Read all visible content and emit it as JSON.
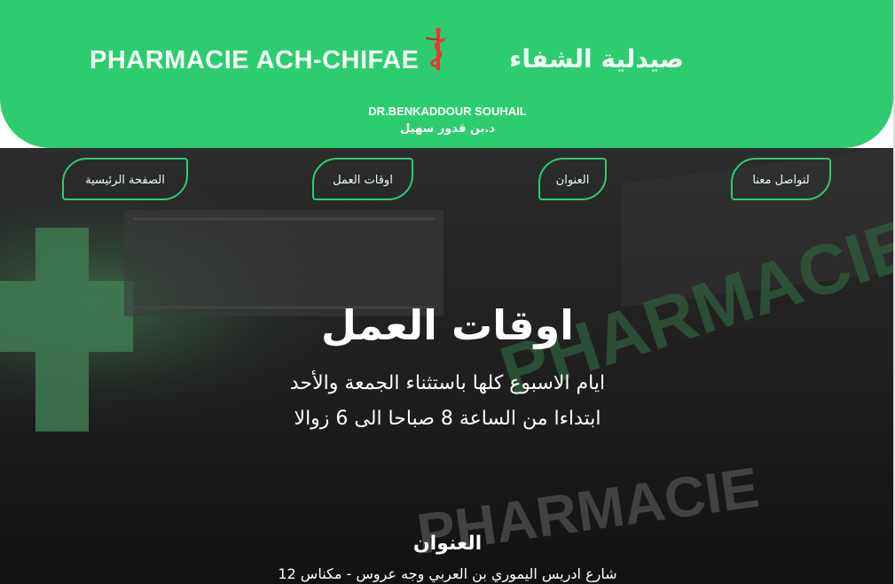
{
  "header": {
    "brand_latin": "PHARMACIE ACH-CHIFAE",
    "brand_arabic": "صيدلية الشفاء",
    "doctor_latin": "DR.BENKADDOUR SOUHAIL",
    "doctor_arabic": "د.بن قدور سهيل",
    "logo_icon": "caduceus-icon",
    "accent_color": "#2ecc71"
  },
  "nav": {
    "home": "الصفحة الرئيسية",
    "hours": "اوقات العمل",
    "address": "العنوان",
    "contact": "لتواصل معنا"
  },
  "hours_section": {
    "title": "اوقات العمل",
    "line1": "ايام الاسبوع كلها باستثناء الجمعة والأحد",
    "line2": "ابتداءا من الساعة 8 صباحا الى 6 زوالا"
  },
  "address_section": {
    "title": "العنوان",
    "text": "شارع ادريس اليموري بن العربي وجه عروس - مكناس 12"
  },
  "background": {
    "sign_text": "PHARMACIE"
  }
}
